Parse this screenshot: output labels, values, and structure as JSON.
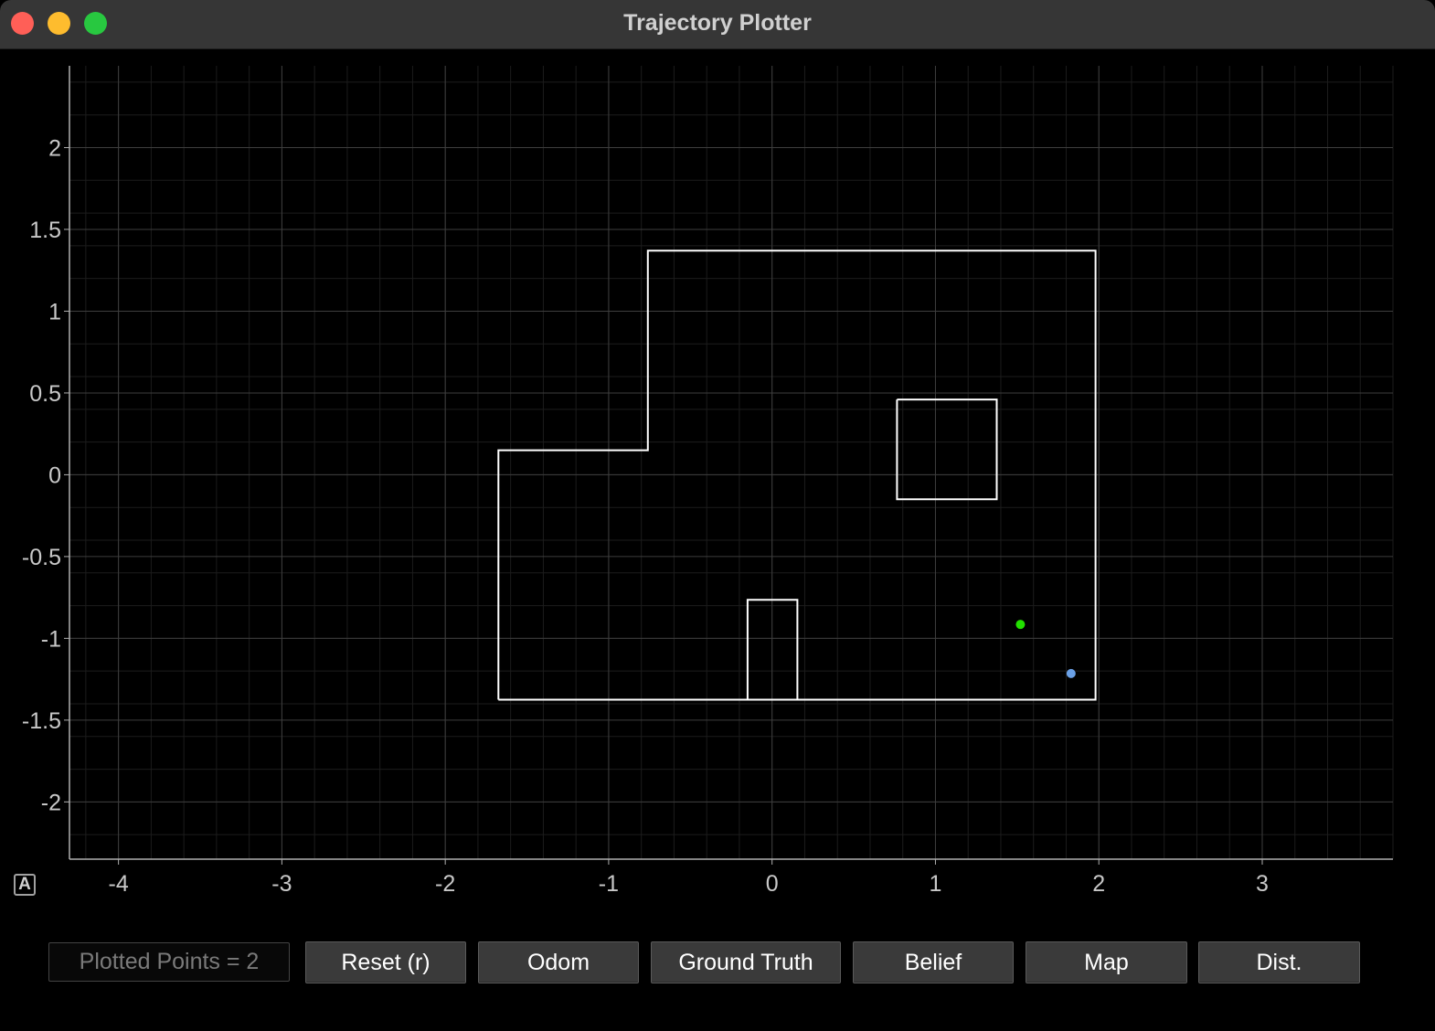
{
  "window": {
    "title": "Trajectory Plotter"
  },
  "toolbar": {
    "counter_text": "Plotted Points = 2",
    "buttons": [
      {
        "label": "Reset (r)"
      },
      {
        "label": "Odom"
      },
      {
        "label": "Ground Truth"
      },
      {
        "label": "Belief"
      },
      {
        "label": "Map"
      },
      {
        "label": "Dist."
      }
    ]
  },
  "auto_range_label": "A",
  "chart_data": {
    "type": "scatter",
    "xlim": [
      -4.3,
      3.8
    ],
    "ylim": [
      -2.35,
      2.5
    ],
    "x_ticks": [
      -4,
      -3,
      -2,
      -1,
      0,
      1,
      2,
      3
    ],
    "y_ticks": [
      2,
      1.5,
      1,
      0.5,
      0,
      -0.5,
      -1,
      -1.5,
      -2
    ],
    "grid": true,
    "minor_grid_step": 0.2,
    "map_polylines": [
      [
        [
          -1.675,
          -1.375
        ],
        [
          -1.675,
          0.15
        ],
        [
          -0.76,
          0.15
        ],
        [
          -0.76,
          1.37
        ],
        [
          1.98,
          1.37
        ],
        [
          1.98,
          -1.375
        ],
        [
          -1.675,
          -1.375
        ]
      ],
      [
        [
          0.765,
          0.46
        ],
        [
          1.375,
          0.46
        ],
        [
          1.375,
          -0.15
        ],
        [
          0.765,
          -0.15
        ],
        [
          0.765,
          0.46
        ]
      ],
      [
        [
          -0.15,
          -1.375
        ],
        [
          -0.15,
          -0.765
        ],
        [
          0.155,
          -0.765
        ],
        [
          0.155,
          -1.375
        ]
      ]
    ],
    "series": [
      {
        "color": "#22e000",
        "points": [
          [
            1.52,
            -0.915
          ]
        ]
      },
      {
        "color": "#6aa0e6",
        "points": [
          [
            1.83,
            -1.215
          ]
        ]
      }
    ],
    "map_color": "#ffffff"
  }
}
